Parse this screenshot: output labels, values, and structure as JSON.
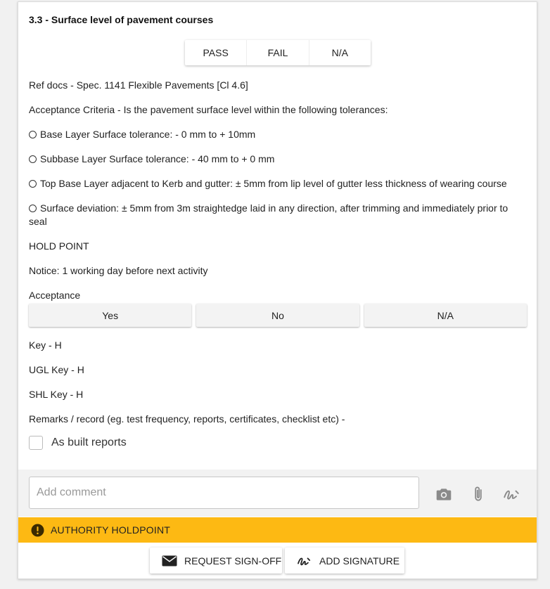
{
  "item": {
    "title": "3.3 - Surface level of pavement courses",
    "result_options": [
      "PASS",
      "FAIL",
      "N/A"
    ]
  },
  "details": {
    "ref_docs": "Ref docs - Spec. 1141 Flexible Pavements [Cl 4.6]",
    "criteria_intro": "Acceptance Criteria - Is the pavement surface level within the following tolerances:",
    "tolerances": [
      "Base Layer Surface tolerance: - 0 mm to + 10mm",
      "Subbase Layer Surface tolerance: - 40 mm to + 0 mm",
      "Top Base Layer adjacent to Kerb and gutter: ± 5mm from lip level of gutter less thickness of wearing course",
      "Surface deviation: ± 5mm from 3m straightedge laid in any direction, after trimming and immediately prior to seal"
    ],
    "hold_point": "HOLD POINT",
    "notice": "Notice: 1 working day before next activity",
    "acceptance_label": "Acceptance",
    "acceptance_options": [
      "Yes",
      "No",
      "N/A"
    ],
    "key": "Key - H",
    "ugl_key": "UGL Key - H",
    "shl_key": "SHL Key - H",
    "remarks": "Remarks / record (eg. test frequency, reports, certificates, checklist etc) -",
    "checkbox_label": "As built reports"
  },
  "comment": {
    "placeholder": "Add comment",
    "icons": [
      "camera-icon",
      "paperclip-icon",
      "signature-icon"
    ]
  },
  "holdpoint_banner": {
    "text": "AUTHORITY HOLDPOINT",
    "color": "#fdb913",
    "icon": "exclamation-icon"
  },
  "actions": {
    "request_signoff": "REQUEST SIGN-OFF",
    "add_signature": "ADD SIGNATURE"
  }
}
